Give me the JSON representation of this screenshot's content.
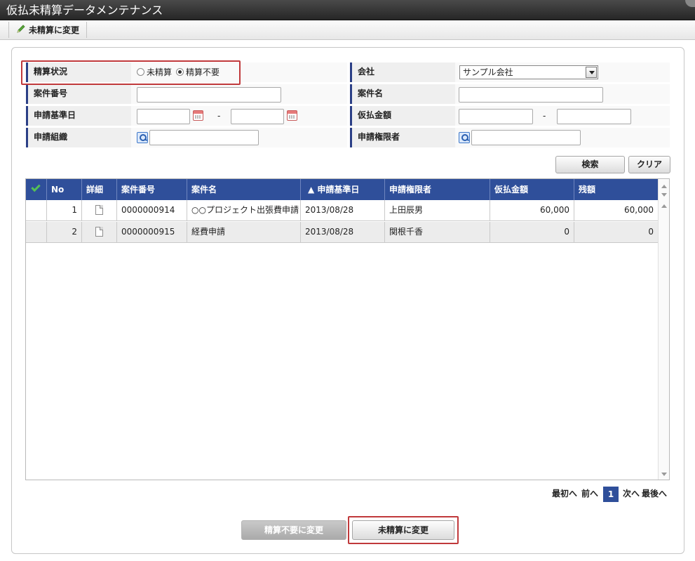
{
  "window": {
    "title": "仮払未精算データメンテナンス"
  },
  "toolbar": {
    "change_unsettled_label": "未精算に変更"
  },
  "search_form": {
    "settlement_status": {
      "label": "精算状況",
      "options": [
        "未精算",
        "精算不要"
      ],
      "selected": "精算不要"
    },
    "company": {
      "label": "会社",
      "value": "サンプル会社"
    },
    "case_number": {
      "label": "案件番号",
      "value": ""
    },
    "case_name": {
      "label": "案件名",
      "value": ""
    },
    "application_date": {
      "label": "申請基準日",
      "from": "",
      "to": "",
      "separator": "-"
    },
    "temporary_amount": {
      "label": "仮払金額",
      "from": "",
      "to": "",
      "separator": "-"
    },
    "applicant_org": {
      "label": "申請組織",
      "value": ""
    },
    "applicant_authority": {
      "label": "申請権限者",
      "value": ""
    },
    "search_label": "検索",
    "clear_label": "クリア"
  },
  "grid": {
    "columns": [
      "No",
      "詳細",
      "案件番号",
      "案件名",
      "▲ 申請基準日",
      "申請権限者",
      "仮払金額",
      "残額"
    ],
    "rows": [
      {
        "no": "1",
        "case_number": "0000000914",
        "case_name": "○○プロジェクト出張費申請",
        "date": "2013/08/28",
        "applicant": "上田辰男",
        "amount": "60,000",
        "remaining": "60,000"
      },
      {
        "no": "2",
        "case_number": "0000000915",
        "case_name": "経費申請",
        "date": "2013/08/28",
        "applicant": "関根千香",
        "amount": "0",
        "remaining": "0"
      }
    ]
  },
  "pager": {
    "first": "最初へ",
    "prev": "前へ",
    "current": "1",
    "next": "次へ",
    "last": "最後へ"
  },
  "footer": {
    "change_to_no_settlement": "精算不要に変更",
    "change_to_unsettled": "未精算に変更"
  },
  "colors": {
    "header_blue": "#2f4f9a",
    "highlight_red": "#c0393b"
  }
}
